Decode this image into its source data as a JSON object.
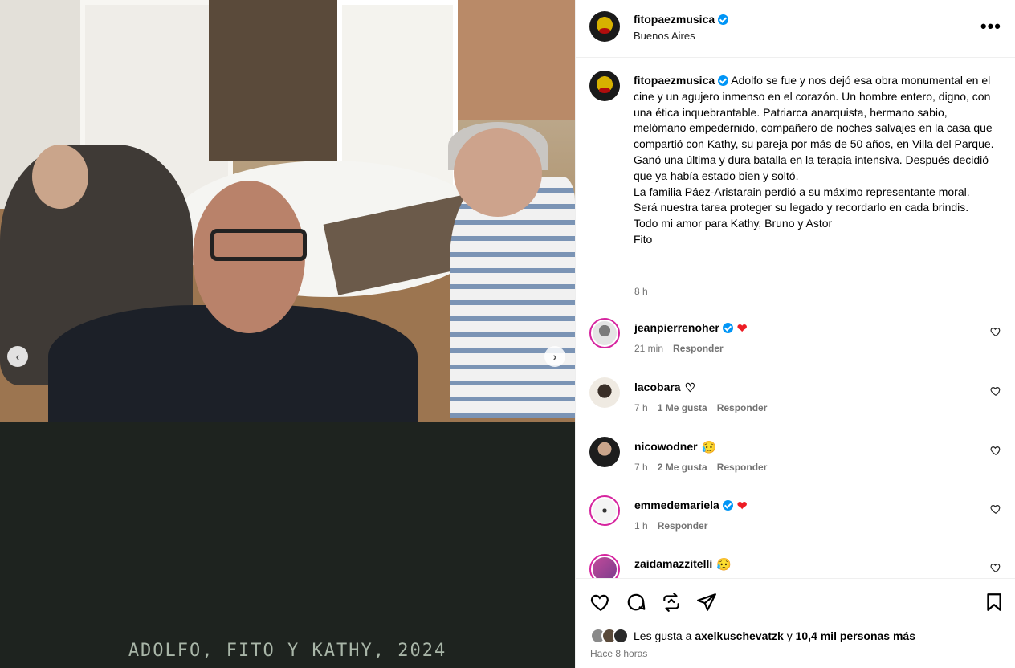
{
  "post": {
    "username": "fitopaezmusica",
    "location": "Buenos Aires",
    "image_caption": "ADOLFO, FITO Y KATHY, 2024"
  },
  "caption": {
    "username": "fitopaezmusica",
    "text": "Adolfo se fue y nos dejó esa obra monumental en el cine y un agujero inmenso en el corazón. Un hombre entero, digno, con una ética inquebrantable. Patriarca anarquista, hermano sabio, melómano empedernido, compañero de noches salvajes en la casa que compartió con Kathy, su pareja por más de 50 años, en Villa del Parque.\nGanó una última y dura batalla en la terapia intensiva. Después decidió que ya había estado bien y soltó.\nLa familia Páez-Aristarain perdió a su máximo representante moral. Será nuestra tarea proteger su legado y recordarlo en cada brindis.\nTodo mi amor para Kathy, Bruno y Astor\nFito",
    "time": "8 h"
  },
  "comments": [
    {
      "username": "jeanpierrenoher",
      "verified": true,
      "emoji": "❤",
      "time": "21 min",
      "likes": "",
      "reply": "Responder"
    },
    {
      "username": "lacobara",
      "verified": false,
      "emoji": "♡",
      "time": "7 h",
      "likes": "1 Me gusta",
      "reply": "Responder"
    },
    {
      "username": "nicowodner",
      "verified": false,
      "emoji": "😥",
      "time": "7 h",
      "likes": "2 Me gusta",
      "reply": "Responder"
    },
    {
      "username": "emmedemariela",
      "verified": true,
      "emoji": "❤",
      "time": "1 h",
      "likes": "",
      "reply": "Responder"
    },
    {
      "username": "zaidamazzitelli",
      "verified": false,
      "emoji": "😥",
      "time": "",
      "likes": "",
      "reply": ""
    }
  ],
  "likes": {
    "prefix": "Les gusta a",
    "user": "axelkuschevatzk",
    "connector": "y",
    "others": "10,4 mil personas más"
  },
  "posted_ago": "Hace 8 horas",
  "icons": {
    "more": "more-options-icon",
    "like": "heart-icon",
    "comment": "comment-icon",
    "share": "repost-icon",
    "send": "send-icon",
    "save": "bookmark-icon",
    "prev": "chevron-left-icon",
    "next": "chevron-right-icon"
  },
  "colors": {
    "verified": "#0095f6",
    "heart": "#ed1c24",
    "muted": "#737373",
    "media_bg": "#1e231f"
  }
}
